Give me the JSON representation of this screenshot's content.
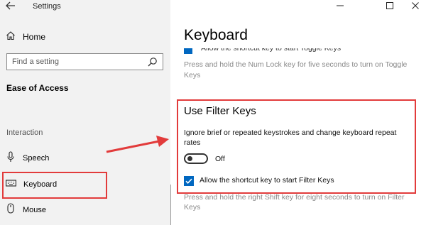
{
  "window": {
    "title": "Settings",
    "controls": {
      "minimize_icon": "minimize-icon",
      "maximize_icon": "maximize-icon",
      "close_icon": "close-icon"
    }
  },
  "sidebar": {
    "home_label": "Home",
    "search_placeholder": "Find a setting",
    "section_title": "Ease of Access",
    "group_label": "Interaction",
    "items": [
      {
        "label": "Speech",
        "icon": "microphone-icon"
      },
      {
        "label": "Keyboard",
        "icon": "keyboard-icon",
        "selected": true
      },
      {
        "label": "Mouse",
        "icon": "mouse-icon"
      }
    ]
  },
  "main": {
    "title": "Keyboard",
    "toggle_keys": {
      "shortcut_label": "Allow the shortcut key to start Toggle Keys",
      "shortcut_checked": true,
      "description": "Press and hold the Num Lock key for five seconds to turn on Toggle Keys"
    },
    "filter_keys": {
      "heading": "Use Filter Keys",
      "description": "Ignore brief or repeated keystrokes and change keyboard repeat rates",
      "toggle_on": false,
      "toggle_state": "Off",
      "shortcut_label": "Allow the shortcut key to start Filter Keys",
      "shortcut_checked": true,
      "shortcut_description": "Press and hold the right Shift key for eight seconds to turn on Filter Keys"
    }
  },
  "colors": {
    "accent": "#0067c0",
    "annotation_red": "#e23b3b",
    "sidebar_bg": "#f2f2f2"
  }
}
